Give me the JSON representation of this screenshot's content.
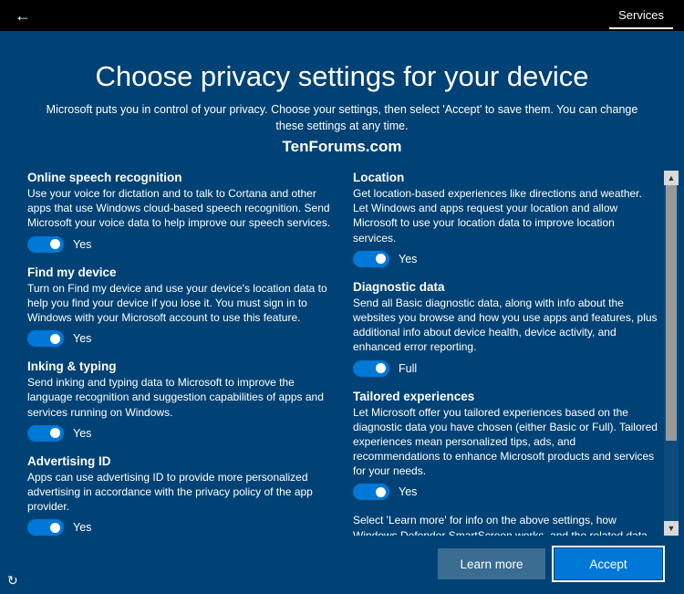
{
  "titlebar": {
    "services_label": "Services"
  },
  "header": {
    "title": "Choose privacy settings for your device",
    "subtitle": "Microsoft puts you in control of your privacy. Choose your settings, then select 'Accept' to save them. You can change these settings at any time.",
    "watermark": "TenForums.com"
  },
  "left": [
    {
      "title": "Online speech recognition",
      "desc": "Use your voice for dictation and to talk to Cortana and other apps that use Windows cloud-based speech recognition. Send Microsoft your voice data to help improve our speech services.",
      "label": "Yes"
    },
    {
      "title": "Find my device",
      "desc": "Turn on Find my device and use your device's location data to help you find your device if you lose it. You must sign in to Windows with your Microsoft account to use this feature.",
      "label": "Yes"
    },
    {
      "title": "Inking & typing",
      "desc": "Send inking and typing data to Microsoft to improve the language recognition and suggestion capabilities of apps and services running on Windows.",
      "label": "Yes"
    },
    {
      "title": "Advertising ID",
      "desc": "Apps can use advertising ID to provide more personalized advertising in accordance with the privacy policy of the app provider.",
      "label": "Yes"
    }
  ],
  "right": [
    {
      "title": "Location",
      "desc": "Get location-based experiences like directions and weather. Let Windows and apps request your location and allow Microsoft to use your location data to improve location services.",
      "label": "Yes"
    },
    {
      "title": "Diagnostic data",
      "desc": "Send all Basic diagnostic data, along with info about the websites you browse and how you use apps and features, plus additional info about device health, device activity, and enhanced error reporting.",
      "label": "Full"
    },
    {
      "title": "Tailored experiences",
      "desc": "Let Microsoft offer you tailored experiences based on the diagnostic data you have chosen (either Basic or Full). Tailored experiences mean personalized tips, ads, and recommendations to enhance Microsoft products and services for your needs.",
      "label": "Yes"
    }
  ],
  "footnote": "Select 'Learn more' for info on the above settings, how Windows Defender SmartScreen works, and the related data transfers and uses.",
  "footer": {
    "learn_more": "Learn more",
    "accept": "Accept"
  }
}
